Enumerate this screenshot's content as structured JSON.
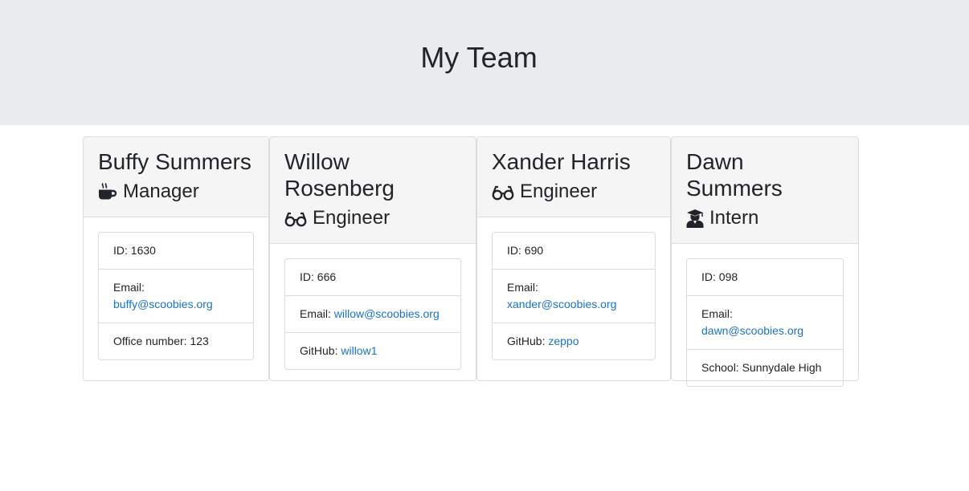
{
  "page": {
    "title": "My Team"
  },
  "employees": [
    {
      "name": "Buffy Summers",
      "role": "Manager",
      "role_icon": "coffee-icon",
      "id_label": "ID: 1630",
      "email_prefix": "Email:",
      "email": "buffy@scoobies.org",
      "extra_prefix": "Office number: 123",
      "extra_link": ""
    },
    {
      "name": "Willow Rosenberg",
      "role": "Engineer",
      "role_icon": "glasses-icon",
      "id_label": "ID: 666",
      "email_prefix": "Email:",
      "email": "willow@scoobies.org",
      "extra_prefix": "GitHub:",
      "extra_link": "willow1"
    },
    {
      "name": "Xander Harris",
      "role": "Engineer",
      "role_icon": "glasses-icon",
      "id_label": "ID: 690",
      "email_prefix": "Email:",
      "email": "xander@scoobies.org",
      "extra_prefix": "GitHub:",
      "extra_link": "zeppo"
    },
    {
      "name": "Dawn Summers",
      "role": "Intern",
      "role_icon": "graduate-icon",
      "id_label": "ID: 098",
      "email_prefix": "Email:",
      "email": "dawn@scoobies.org",
      "extra_prefix": "School: Sunnydale High",
      "extra_link": ""
    }
  ]
}
